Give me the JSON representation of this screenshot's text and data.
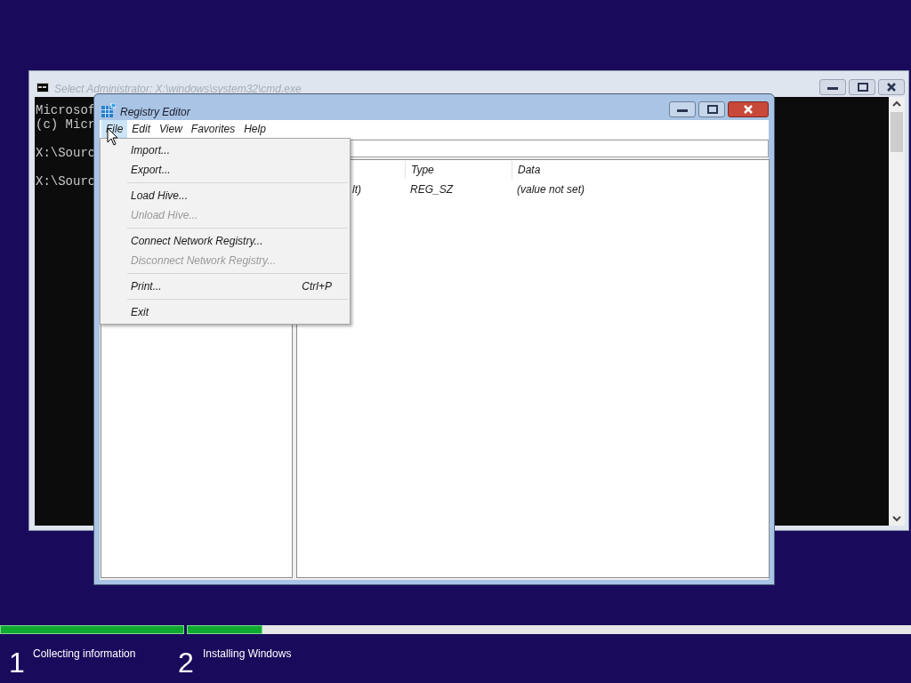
{
  "console_window": {
    "title": "Select Administrator: X:\\windows\\system32\\cmd.exe",
    "active": false,
    "output_blocks": [
      [
        "Microsof",
        "(c) Micr"
      ],
      [
        "X:\\Sourc"
      ],
      [
        "X:\\Sourc"
      ]
    ]
  },
  "registry_editor": {
    "title": "Registry Editor",
    "active": true,
    "menu_bar": [
      {
        "label": "File",
        "selected": true
      },
      {
        "label": "Edit",
        "selected": false
      },
      {
        "label": "View",
        "selected": false
      },
      {
        "label": "Favorites",
        "selected": false
      },
      {
        "label": "Help",
        "selected": false
      }
    ],
    "file_menu": [
      {
        "kind": "item",
        "label": "Import...",
        "disabled": false
      },
      {
        "kind": "item",
        "label": "Export...",
        "disabled": false
      },
      {
        "kind": "separator"
      },
      {
        "kind": "item",
        "label": "Load Hive...",
        "disabled": false
      },
      {
        "kind": "item",
        "label": "Unload Hive...",
        "disabled": true
      },
      {
        "kind": "separator"
      },
      {
        "kind": "item",
        "label": "Connect Network Registry...",
        "disabled": false
      },
      {
        "kind": "item",
        "label": "Disconnect Network Registry...",
        "disabled": true
      },
      {
        "kind": "separator"
      },
      {
        "kind": "item",
        "label": "Print...",
        "shortcut": "Ctrl+P",
        "disabled": false
      },
      {
        "kind": "separator"
      },
      {
        "kind": "item",
        "label": "Exit",
        "disabled": false
      }
    ],
    "values_list": {
      "headers": {
        "type": "Type",
        "data": "Data"
      },
      "entries": [
        {
          "name": "lt)",
          "type": "REG_SZ",
          "data": "(value not set)"
        }
      ]
    }
  },
  "setup_progress": {
    "steps": [
      {
        "number": "1",
        "label": "Collecting information",
        "level": 1
      },
      {
        "number": "2",
        "label": "Installing Windows",
        "level": 0.104
      }
    ]
  }
}
